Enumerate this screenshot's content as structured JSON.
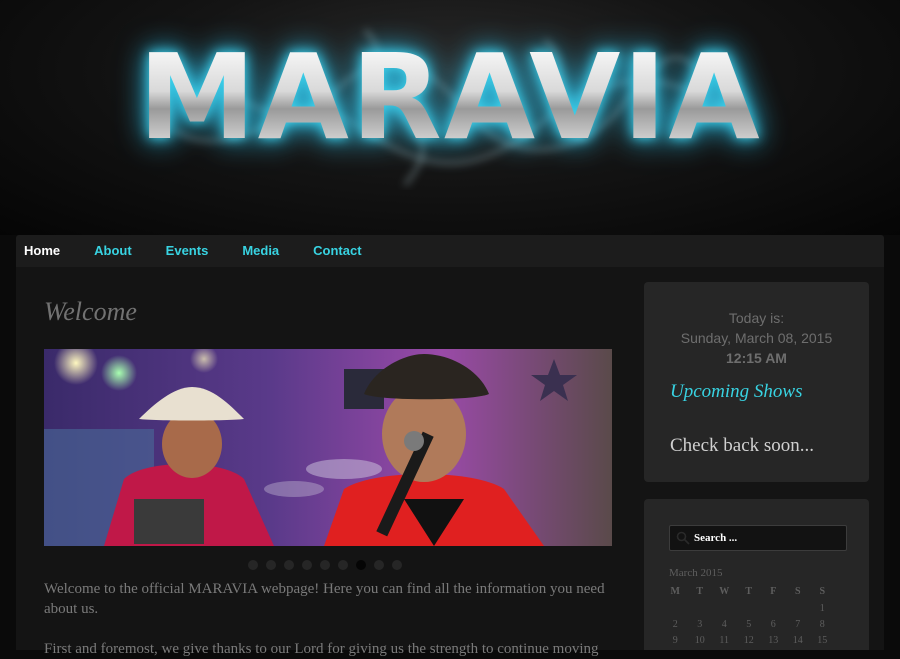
{
  "site": {
    "logo_text": "MARAVIA"
  },
  "nav": {
    "items": [
      {
        "label": "Home"
      },
      {
        "label": "About"
      },
      {
        "label": "Events"
      },
      {
        "label": "Media"
      },
      {
        "label": "Contact"
      }
    ]
  },
  "main": {
    "title": "Welcome",
    "slider": {
      "slide_count": 9,
      "active_index": 6
    },
    "paragraph1": "Welcome to the official MARAVIA webpage! Here you can find all the information you need about us.",
    "paragraph2": "First and foremost, we give thanks to our Lord for giving us the strength to continue moving"
  },
  "sidebar": {
    "today_label": "Today is:",
    "date": "Sunday, March 08, 2015",
    "time": "12:15 AM",
    "upcoming_title": "Upcoming Shows",
    "upcoming_text": "Check back soon...",
    "search_placeholder": "Search ...",
    "calendar": {
      "caption": "March 2015",
      "headers": [
        "M",
        "T",
        "W",
        "T",
        "F",
        "S",
        "S"
      ],
      "rows": [
        [
          "",
          "",
          "",
          "",
          "",
          "",
          "1"
        ],
        [
          "2",
          "3",
          "4",
          "5",
          "6",
          "7",
          "8"
        ],
        [
          "9",
          "10",
          "11",
          "12",
          "13",
          "14",
          "15"
        ]
      ]
    }
  },
  "colors": {
    "accent": "#38d3e2",
    "background": "#0a0a0a",
    "panel": "#141414",
    "widget": "#262626"
  }
}
